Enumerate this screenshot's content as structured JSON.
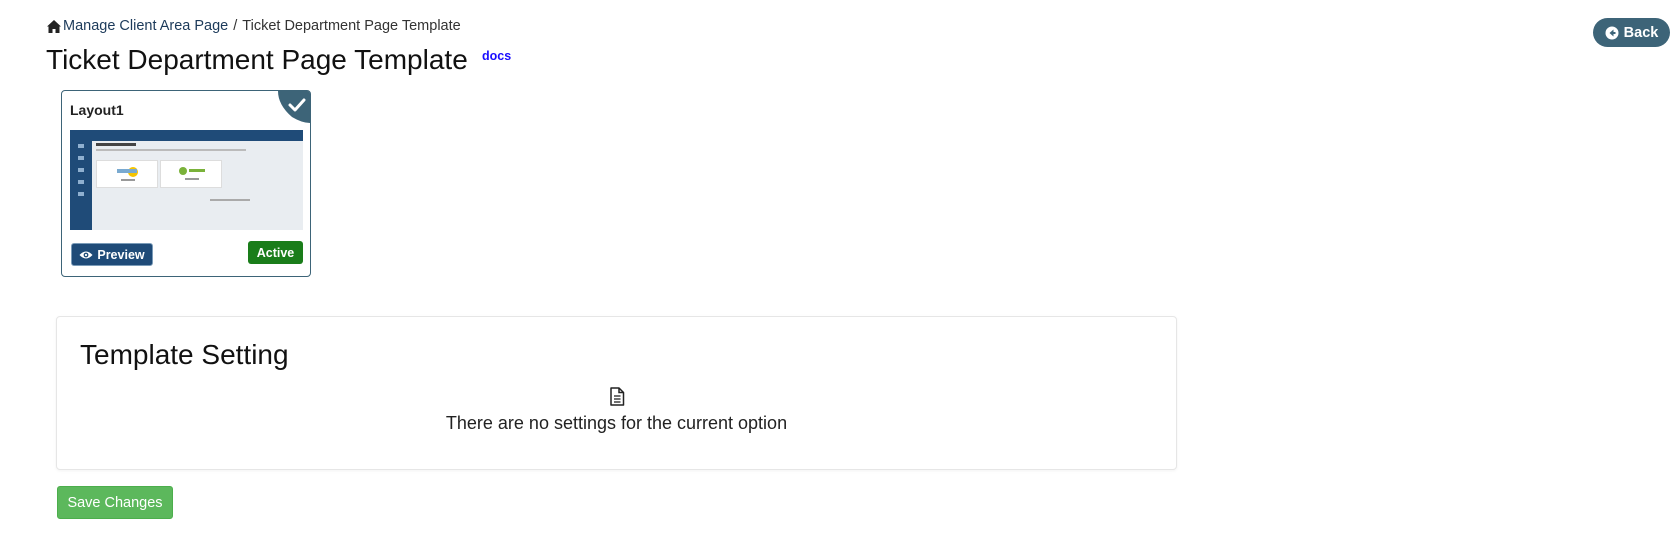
{
  "breadcrumb": {
    "parent_label": "Manage Client Area Page",
    "separator": "/",
    "current_label": "Ticket Department Page Template"
  },
  "header": {
    "title": "Ticket Department Page Template",
    "docs_label": "docs",
    "back_label": "Back"
  },
  "layouts": [
    {
      "name": "Layout1",
      "preview_label": "Preview",
      "status_label": "Active",
      "selected": true
    }
  ],
  "settings": {
    "title": "Template Setting",
    "empty_message": "There are no settings for the current option"
  },
  "actions": {
    "save_label": "Save Changes"
  },
  "colors": {
    "primary": "#1f4b78",
    "back_button": "#3d6478",
    "active_badge": "#1a7d1a",
    "save_button": "#5cb85c",
    "docs_link": "#1a0dff"
  }
}
